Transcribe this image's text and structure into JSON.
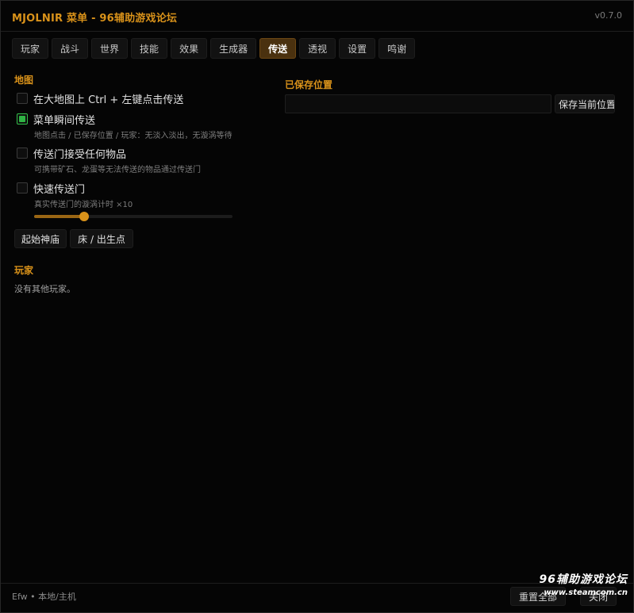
{
  "window": {
    "title": "MJOLNIR 菜单 - 96辅助游戏论坛",
    "version": "v0.7.0"
  },
  "tabs": [
    {
      "label": "玩家",
      "active": false
    },
    {
      "label": "战斗",
      "active": false
    },
    {
      "label": "世界",
      "active": false
    },
    {
      "label": "技能",
      "active": false
    },
    {
      "label": "效果",
      "active": false
    },
    {
      "label": "生成器",
      "active": false
    },
    {
      "label": "传送",
      "active": true
    },
    {
      "label": "透视",
      "active": false
    },
    {
      "label": "设置",
      "active": false
    },
    {
      "label": "鸣谢",
      "active": false
    }
  ],
  "map_section": {
    "header": "地图",
    "options": [
      {
        "label": "在大地图上 Ctrl + 左键点击传送",
        "checked": false,
        "hint": ""
      },
      {
        "label": "菜单瞬间传送",
        "checked": true,
        "hint": "地图点击 / 已保存位置 / 玩家：无淡入淡出，无漩涡等待"
      },
      {
        "label": "传送门接受任何物品",
        "checked": false,
        "hint": "可携带矿石、龙蛋等无法传送的物品通过传送门"
      },
      {
        "label": "快速传送门",
        "checked": false,
        "hint": "真实传送门的漩涡计时 ×10"
      }
    ],
    "slider_value": 0.25,
    "buttons": {
      "shrine": "起始神庙",
      "bed": "床 / 出生点"
    }
  },
  "players_section": {
    "header": "玩家",
    "empty_text": "没有其他玩家。"
  },
  "saved_section": {
    "header": "已保存位置",
    "input_value": "",
    "save_button": "保存当前位置"
  },
  "footer": {
    "status": "Efw  •  本地/主机",
    "reset_button": "重置全部",
    "close_button": "关闭"
  },
  "watermark": {
    "line1": "96辅助游戏论坛",
    "line2": "www.steamcom.cn"
  },
  "colors": {
    "accent": "#d9921a",
    "tab_active_bg": "#4a310f",
    "checkbox_on": "#2fb444"
  }
}
